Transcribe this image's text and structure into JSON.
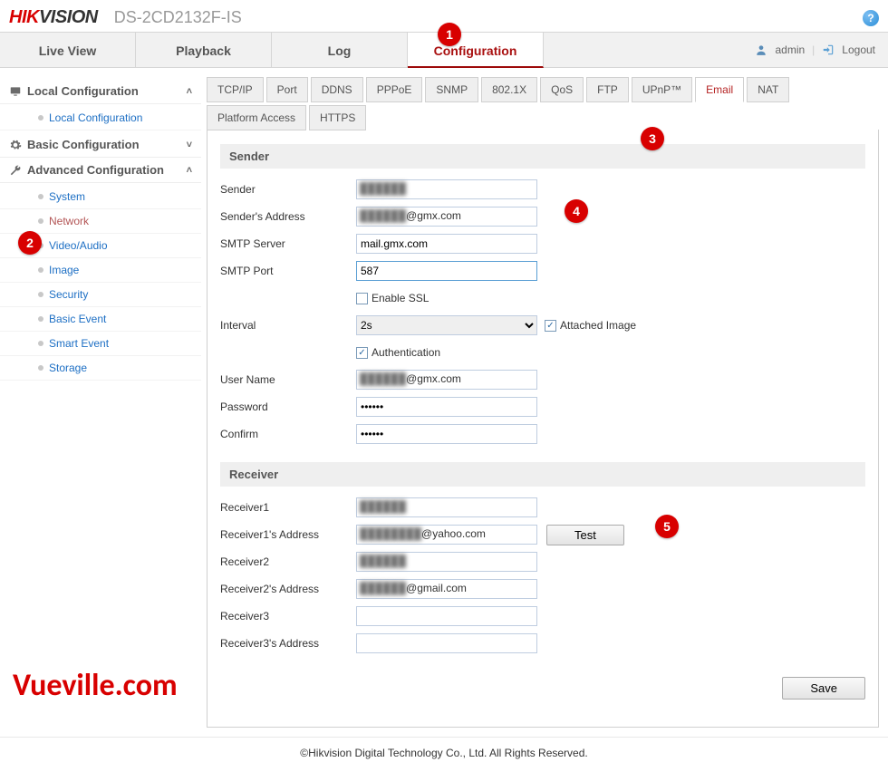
{
  "brand": {
    "part1": "HIK",
    "part2": "VISION"
  },
  "model": "DS-2CD2132F-IS",
  "help": "?",
  "topnav": {
    "tabs": [
      "Live View",
      "Playback",
      "Log",
      "Configuration"
    ],
    "active_index": 3
  },
  "user": {
    "name": "admin",
    "logout": "Logout"
  },
  "sidebar": {
    "sections": [
      {
        "label": "Local Configuration",
        "open": true,
        "items": [
          "Local Configuration"
        ]
      },
      {
        "label": "Basic Configuration",
        "open": false,
        "items": []
      },
      {
        "label": "Advanced Configuration",
        "open": true,
        "items": [
          "System",
          "Network",
          "Video/Audio",
          "Image",
          "Security",
          "Basic Event",
          "Smart Event",
          "Storage"
        ],
        "active_item_index": 1
      }
    ]
  },
  "subtabs": {
    "items": [
      "TCP/IP",
      "Port",
      "DDNS",
      "PPPoE",
      "SNMP",
      "802.1X",
      "QoS",
      "FTP",
      "UPnP™",
      "Email",
      "NAT",
      "Platform Access",
      "HTTPS"
    ],
    "active_index": 9
  },
  "form": {
    "sender_section": "Sender",
    "receiver_section": "Receiver",
    "labels": {
      "sender": "Sender",
      "sender_addr": "Sender's Address",
      "smtp_server": "SMTP Server",
      "smtp_port": "SMTP Port",
      "enable_ssl": "Enable SSL",
      "interval": "Interval",
      "attached_image": "Attached Image",
      "authentication": "Authentication",
      "user_name": "User Name",
      "password": "Password",
      "confirm": "Confirm",
      "r1": "Receiver1",
      "r1a": "Receiver1's Address",
      "r2": "Receiver2",
      "r2a": "Receiver2's Address",
      "r3": "Receiver3",
      "r3a": "Receiver3's Address"
    },
    "values": {
      "sender": "██████",
      "sender_addr_blur": "██████",
      "sender_addr_suffix": "@gmx.com",
      "smtp_server": "mail.gmx.com",
      "smtp_port": "587",
      "interval": "2s",
      "enable_ssl_checked": false,
      "attached_image_checked": true,
      "authentication_checked": true,
      "user_name_blur": "██████",
      "user_name_suffix": "@gmx.com",
      "password": "••••••",
      "confirm": "••••••",
      "r1": "██████",
      "r1a_blur": "████████",
      "r1a_suffix": "@yahoo.com",
      "r2": "██████",
      "r2a_blur": "██████",
      "r2a_suffix": "@gmail.com",
      "r3": "",
      "r3a": ""
    },
    "buttons": {
      "test": "Test",
      "save": "Save"
    }
  },
  "callouts": {
    "1": "1",
    "2": "2",
    "3": "3",
    "4": "4",
    "5": "5"
  },
  "watermark": "Vueville.com",
  "footer": "©Hikvision Digital Technology Co., Ltd. All Rights Reserved."
}
